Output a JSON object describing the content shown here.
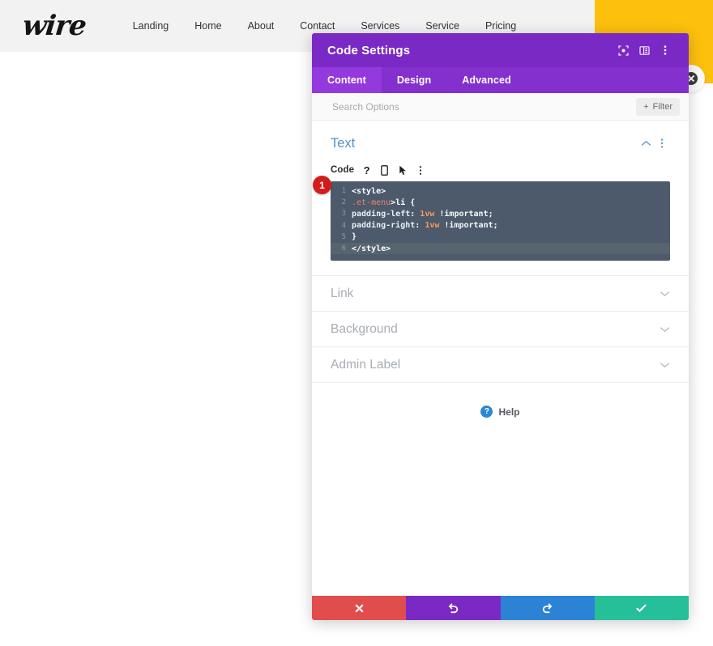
{
  "site": {
    "logo_text": "wire",
    "nav": [
      {
        "label": "Landing",
        "active": false
      },
      {
        "label": "Home",
        "active": false
      },
      {
        "label": "About",
        "active": false
      },
      {
        "label": "Contact",
        "active": false
      },
      {
        "label": "Services",
        "active": true
      },
      {
        "label": "Service",
        "active": false
      },
      {
        "label": "Pricing",
        "active": false
      }
    ],
    "accent_yellow": "#fcc00d",
    "accent_purple": "#7c29c4"
  },
  "modal": {
    "title": "Code Settings",
    "titlebar_color": "#7b29c4",
    "titlebar_icons": [
      "target-icon",
      "layout-panel-icon",
      "kebab-menu-icon"
    ],
    "tabs": [
      {
        "label": "Content",
        "active": true
      },
      {
        "label": "Design",
        "active": false
      },
      {
        "label": "Advanced",
        "active": false
      }
    ],
    "search": {
      "placeholder": "Search Options",
      "value": ""
    },
    "filter_button": {
      "label": "Filter",
      "plus": "+"
    },
    "text_section": {
      "title": "Text",
      "collapse_icon": "chevron-up-icon",
      "kebab_icon": "kebab-menu-icon",
      "field": {
        "label": "Code",
        "icons": [
          "help-icon",
          "mobile-icon",
          "cursor-icon",
          "kebab-menu-icon"
        ],
        "step_badge": "1",
        "editor": {
          "background": "#4c5a6b",
          "active_line": 6,
          "lines": [
            {
              "n": "1",
              "segments": [
                {
                  "t": "<style>",
                  "k": "tag"
                }
              ]
            },
            {
              "n": "2",
              "segments": [
                {
                  "t": ".et-menu",
                  "k": "sel"
                },
                {
                  "t": ">",
                  "k": "elem"
                },
                {
                  "t": "li",
                  "k": "elem"
                },
                {
                  "t": " {",
                  "k": "brace"
                }
              ]
            },
            {
              "n": "3",
              "segments": [
                {
                  "t": "padding-left",
                  "k": "prop"
                },
                {
                  "t": ": ",
                  "k": "imp"
                },
                {
                  "t": "1vw",
                  "k": "val"
                },
                {
                  "t": " !important;",
                  "k": "imp"
                }
              ]
            },
            {
              "n": "4",
              "segments": [
                {
                  "t": "padding-right",
                  "k": "prop"
                },
                {
                  "t": ": ",
                  "k": "imp"
                },
                {
                  "t": "1vw",
                  "k": "val"
                },
                {
                  "t": " !important;",
                  "k": "imp"
                }
              ]
            },
            {
              "n": "5",
              "segments": [
                {
                  "t": "}",
                  "k": "brace"
                }
              ]
            },
            {
              "n": "6",
              "segments": [
                {
                  "t": "</style>",
                  "k": "close"
                }
              ]
            }
          ]
        }
      }
    },
    "collapsed_sections": [
      {
        "title": "Link",
        "chevron": "chevron-down-icon"
      },
      {
        "title": "Background",
        "chevron": "chevron-down-icon"
      },
      {
        "title": "Admin Label",
        "chevron": "chevron-down-icon"
      }
    ],
    "help": {
      "label": "Help",
      "icon_char": "?",
      "icon_color": "#2b87d4"
    },
    "footer_buttons": [
      {
        "name": "cancel",
        "icon": "close-icon",
        "color": "#e14d4d"
      },
      {
        "name": "undo",
        "icon": "undo-icon",
        "color": "#7b29c4"
      },
      {
        "name": "redo",
        "icon": "redo-icon",
        "color": "#2c82d4"
      },
      {
        "name": "save",
        "icon": "check-icon",
        "color": "#25bf9a"
      }
    ]
  }
}
